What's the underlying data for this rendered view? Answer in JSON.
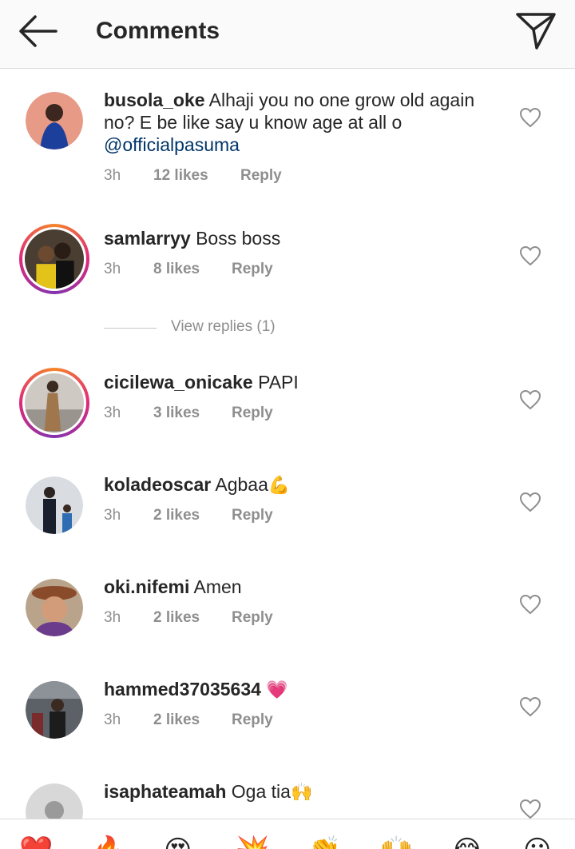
{
  "header": {
    "title": "Comments"
  },
  "comments": [
    {
      "username": "busola_oke",
      "text": " Alhaji you no one grow old again no? E be like say u know age at all o ",
      "mention": "@officialpasuma",
      "time": "3h",
      "likes": "12 likes",
      "reply": "Reply"
    },
    {
      "username": "samlarryy",
      "text": " Boss boss",
      "time": "3h",
      "likes": "8 likes",
      "reply": "Reply"
    },
    {
      "username": "cicilewa_onicake",
      "text": " PAPI",
      "time": "3h",
      "likes": "3 likes",
      "reply": "Reply"
    },
    {
      "username": "koladeoscar",
      "text": " Agbaa",
      "emoji": "💪",
      "time": "3h",
      "likes": "2 likes",
      "reply": "Reply"
    },
    {
      "username": "oki.nifemi",
      "text": " Amen",
      "time": "3h",
      "likes": "2 likes",
      "reply": "Reply"
    },
    {
      "username": "hammed37035634",
      "text": " ",
      "emoji": "💗",
      "time": "3h",
      "likes": "2 likes",
      "reply": "Reply"
    },
    {
      "username": "isaphateamah",
      "text": " Oga tia",
      "emoji": "🙌"
    }
  ],
  "view_replies": "View replies (1)",
  "emoji_bar": [
    "❤️",
    "🔥",
    "😍",
    "💥",
    "👏",
    "🙌",
    "😂",
    "😮"
  ]
}
